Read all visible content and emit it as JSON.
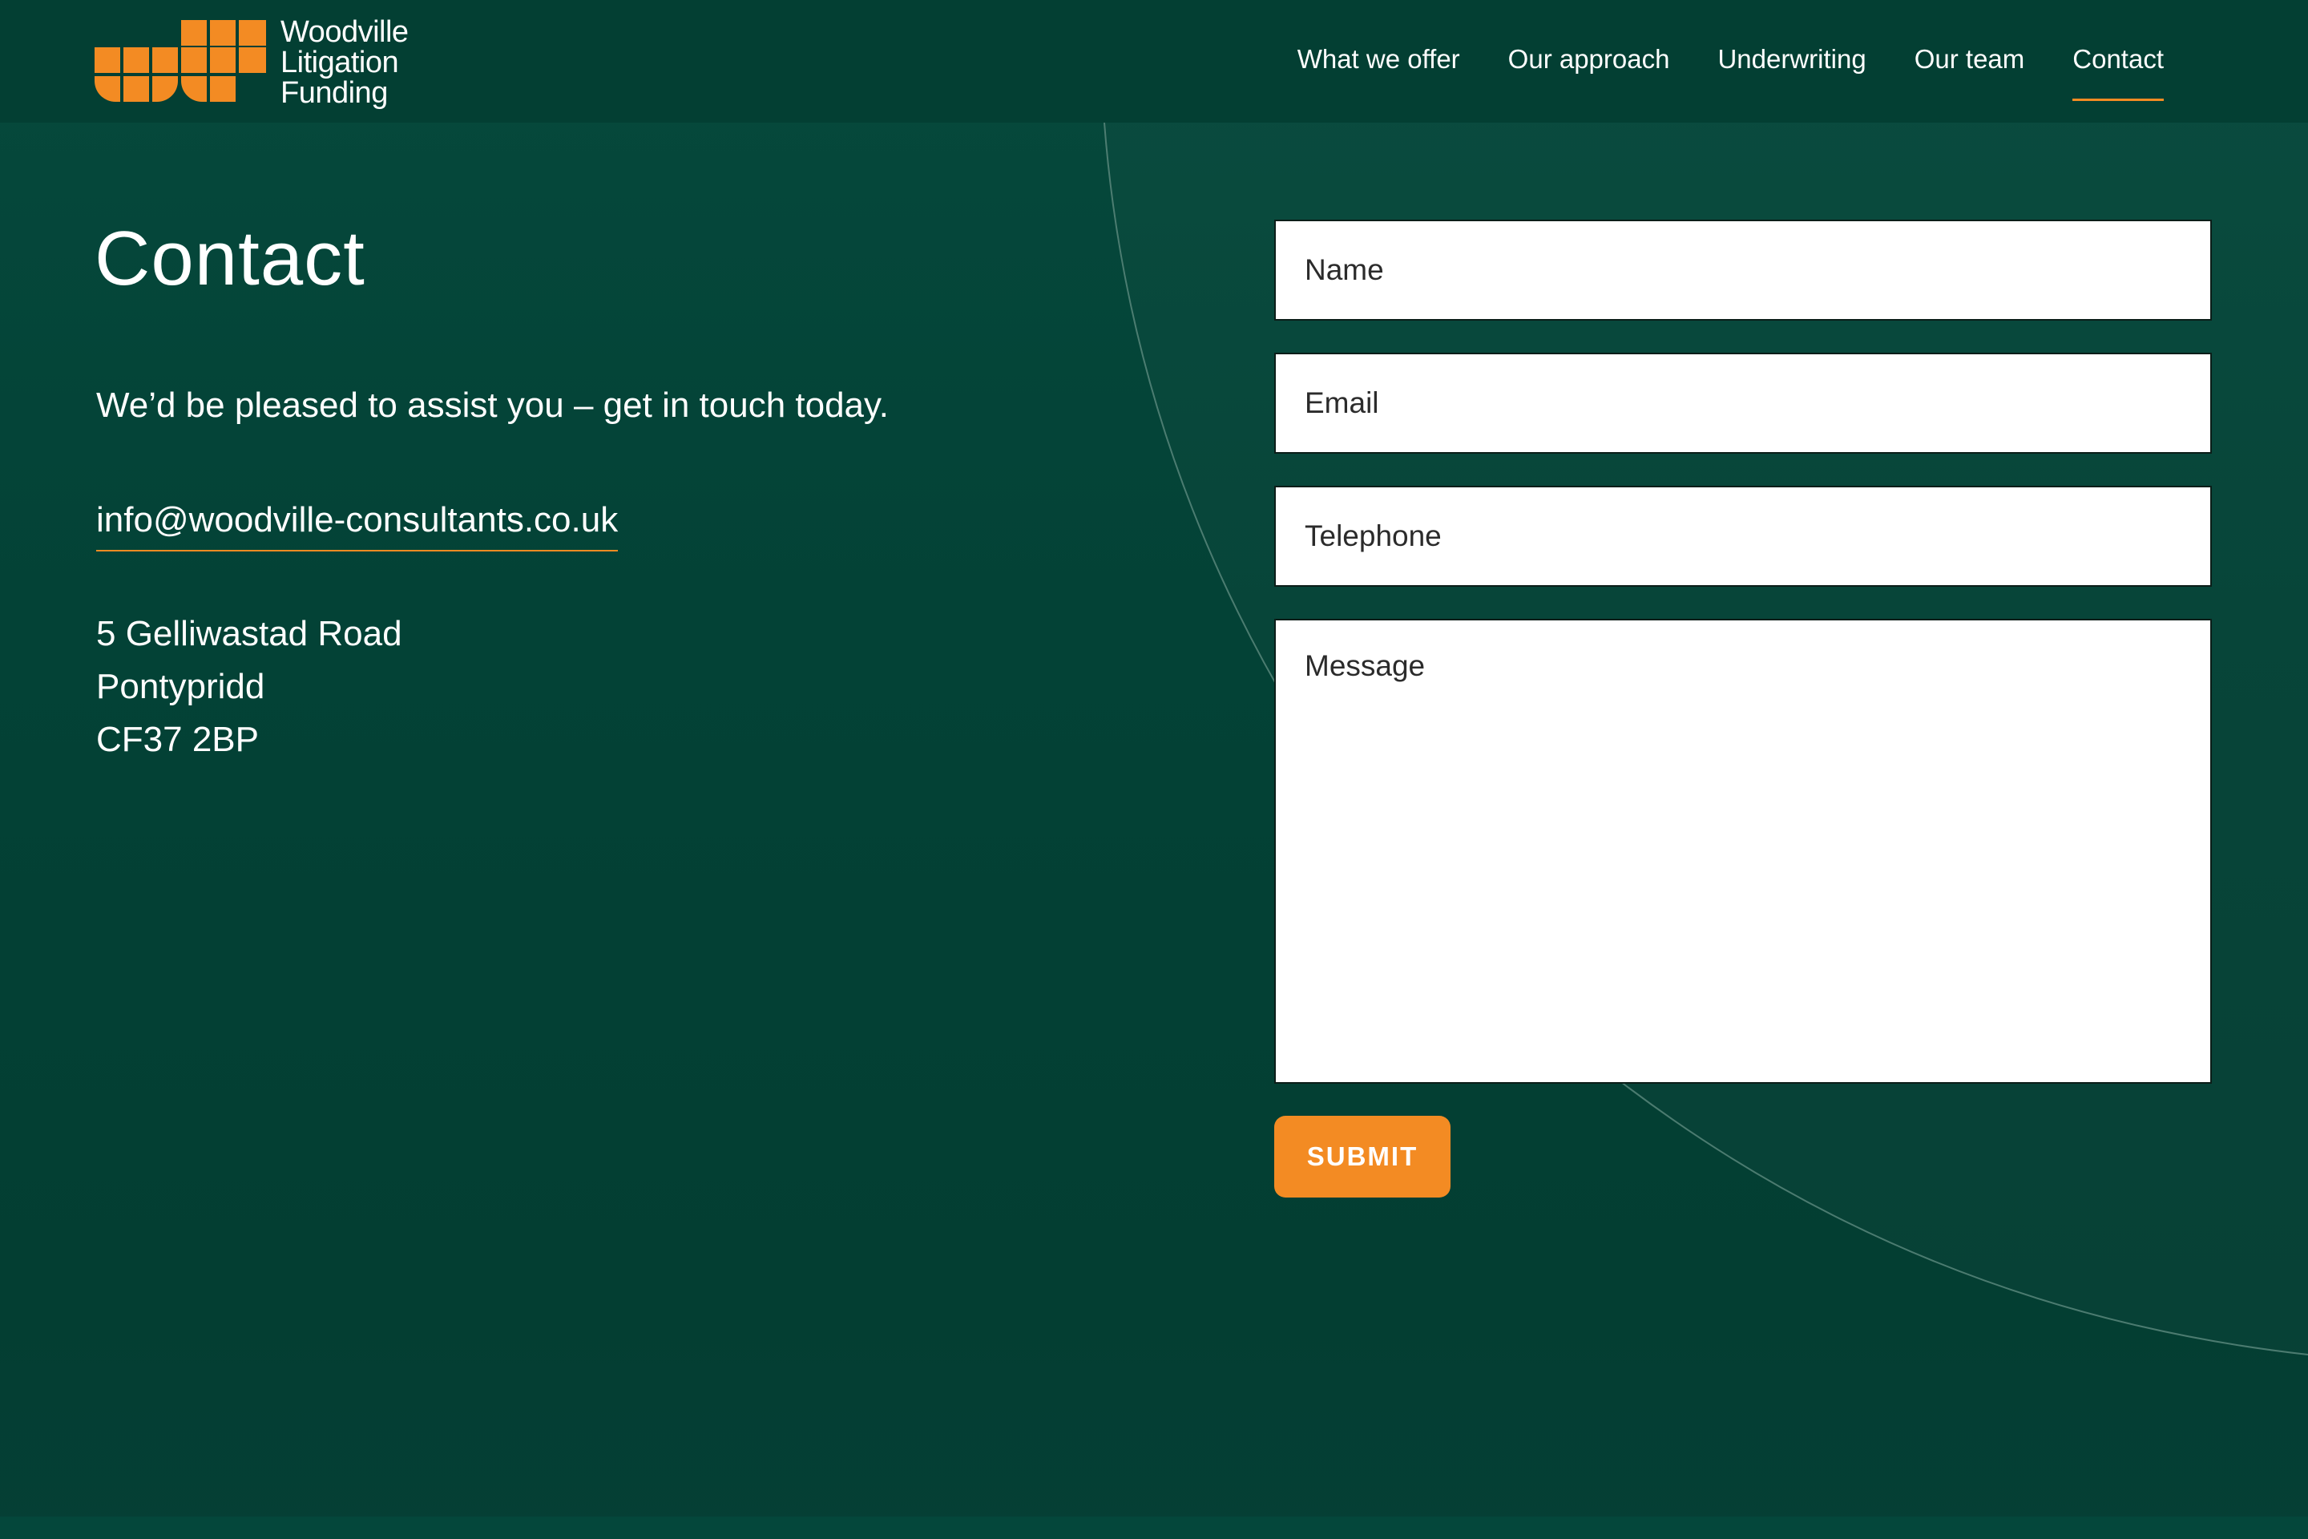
{
  "brand": {
    "name_lines": [
      "Woodville",
      "Litigation",
      "Funding"
    ],
    "logo_icon": "wlf-logo-mark",
    "accent_color": "#f38b23",
    "background_color": "#034236"
  },
  "nav": {
    "items": [
      {
        "label": "What we offer",
        "active": false
      },
      {
        "label": "Our approach",
        "active": false
      },
      {
        "label": "Underwriting",
        "active": false
      },
      {
        "label": "Our team",
        "active": false
      },
      {
        "label": "Contact",
        "active": true
      }
    ]
  },
  "main": {
    "title": "Contact",
    "lead": "We’d be pleased to assist you – get in touch today.",
    "email": "info@woodville-consultants.co.uk",
    "address": [
      "5 Gelliwastad Road",
      "Pontypridd",
      "CF37 2BP"
    ]
  },
  "form": {
    "name_placeholder": "Name",
    "email_placeholder": "Email",
    "telephone_placeholder": "Telephone",
    "message_placeholder": "Message",
    "submit_label": "SUBMIT"
  }
}
